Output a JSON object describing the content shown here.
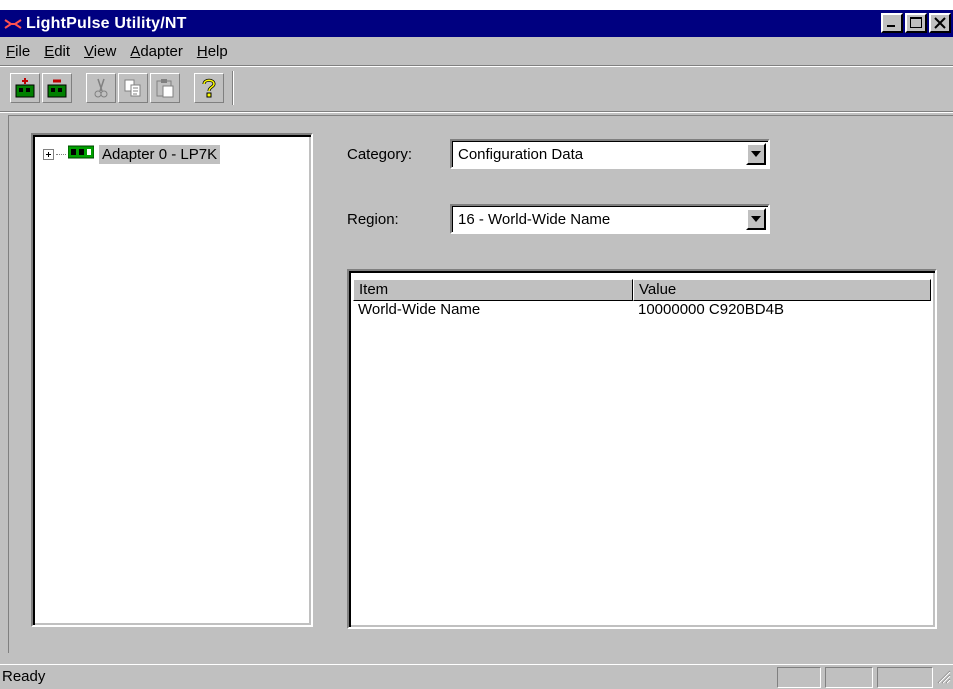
{
  "window": {
    "title": "LightPulse Utility/NT"
  },
  "title_buttons": [
    {
      "name": "minimize",
      "icon": "minimize-icon"
    },
    {
      "name": "maximize",
      "icon": "maximize-icon"
    },
    {
      "name": "close",
      "icon": "close-icon"
    }
  ],
  "menu": [
    {
      "label": "File",
      "accel": "F",
      "rest": "ile"
    },
    {
      "label": "Edit",
      "accel": "E",
      "rest": "dit"
    },
    {
      "label": "View",
      "accel": "V",
      "rest": "iew"
    },
    {
      "label": "Adapter",
      "accel": "A",
      "rest": "dapter"
    },
    {
      "label": "Help",
      "accel": "H",
      "rest": "elp"
    }
  ],
  "toolbar": {
    "buttons": [
      "add-adapter-icon",
      "remove-adapter-icon",
      "cut-icon",
      "copy-icon",
      "paste-icon",
      "help-icon"
    ]
  },
  "tree": {
    "nodes": [
      {
        "label": "Adapter 0 - LP7K",
        "expanded": false,
        "icon": "adapter-card-icon"
      }
    ]
  },
  "category": {
    "label": "Category:",
    "value": "Configuration Data"
  },
  "region": {
    "label": "Region:",
    "value": "16 - World-Wide Name"
  },
  "table": {
    "columns": [
      "Item",
      "Value"
    ],
    "rows": [
      [
        "World-Wide Name",
        "10000000 C920BD4B"
      ]
    ]
  },
  "status": {
    "text": "Ready"
  },
  "colors": {
    "titlebar": "#000080",
    "face": "#c0c0c0",
    "icon_green": "#00a000"
  }
}
